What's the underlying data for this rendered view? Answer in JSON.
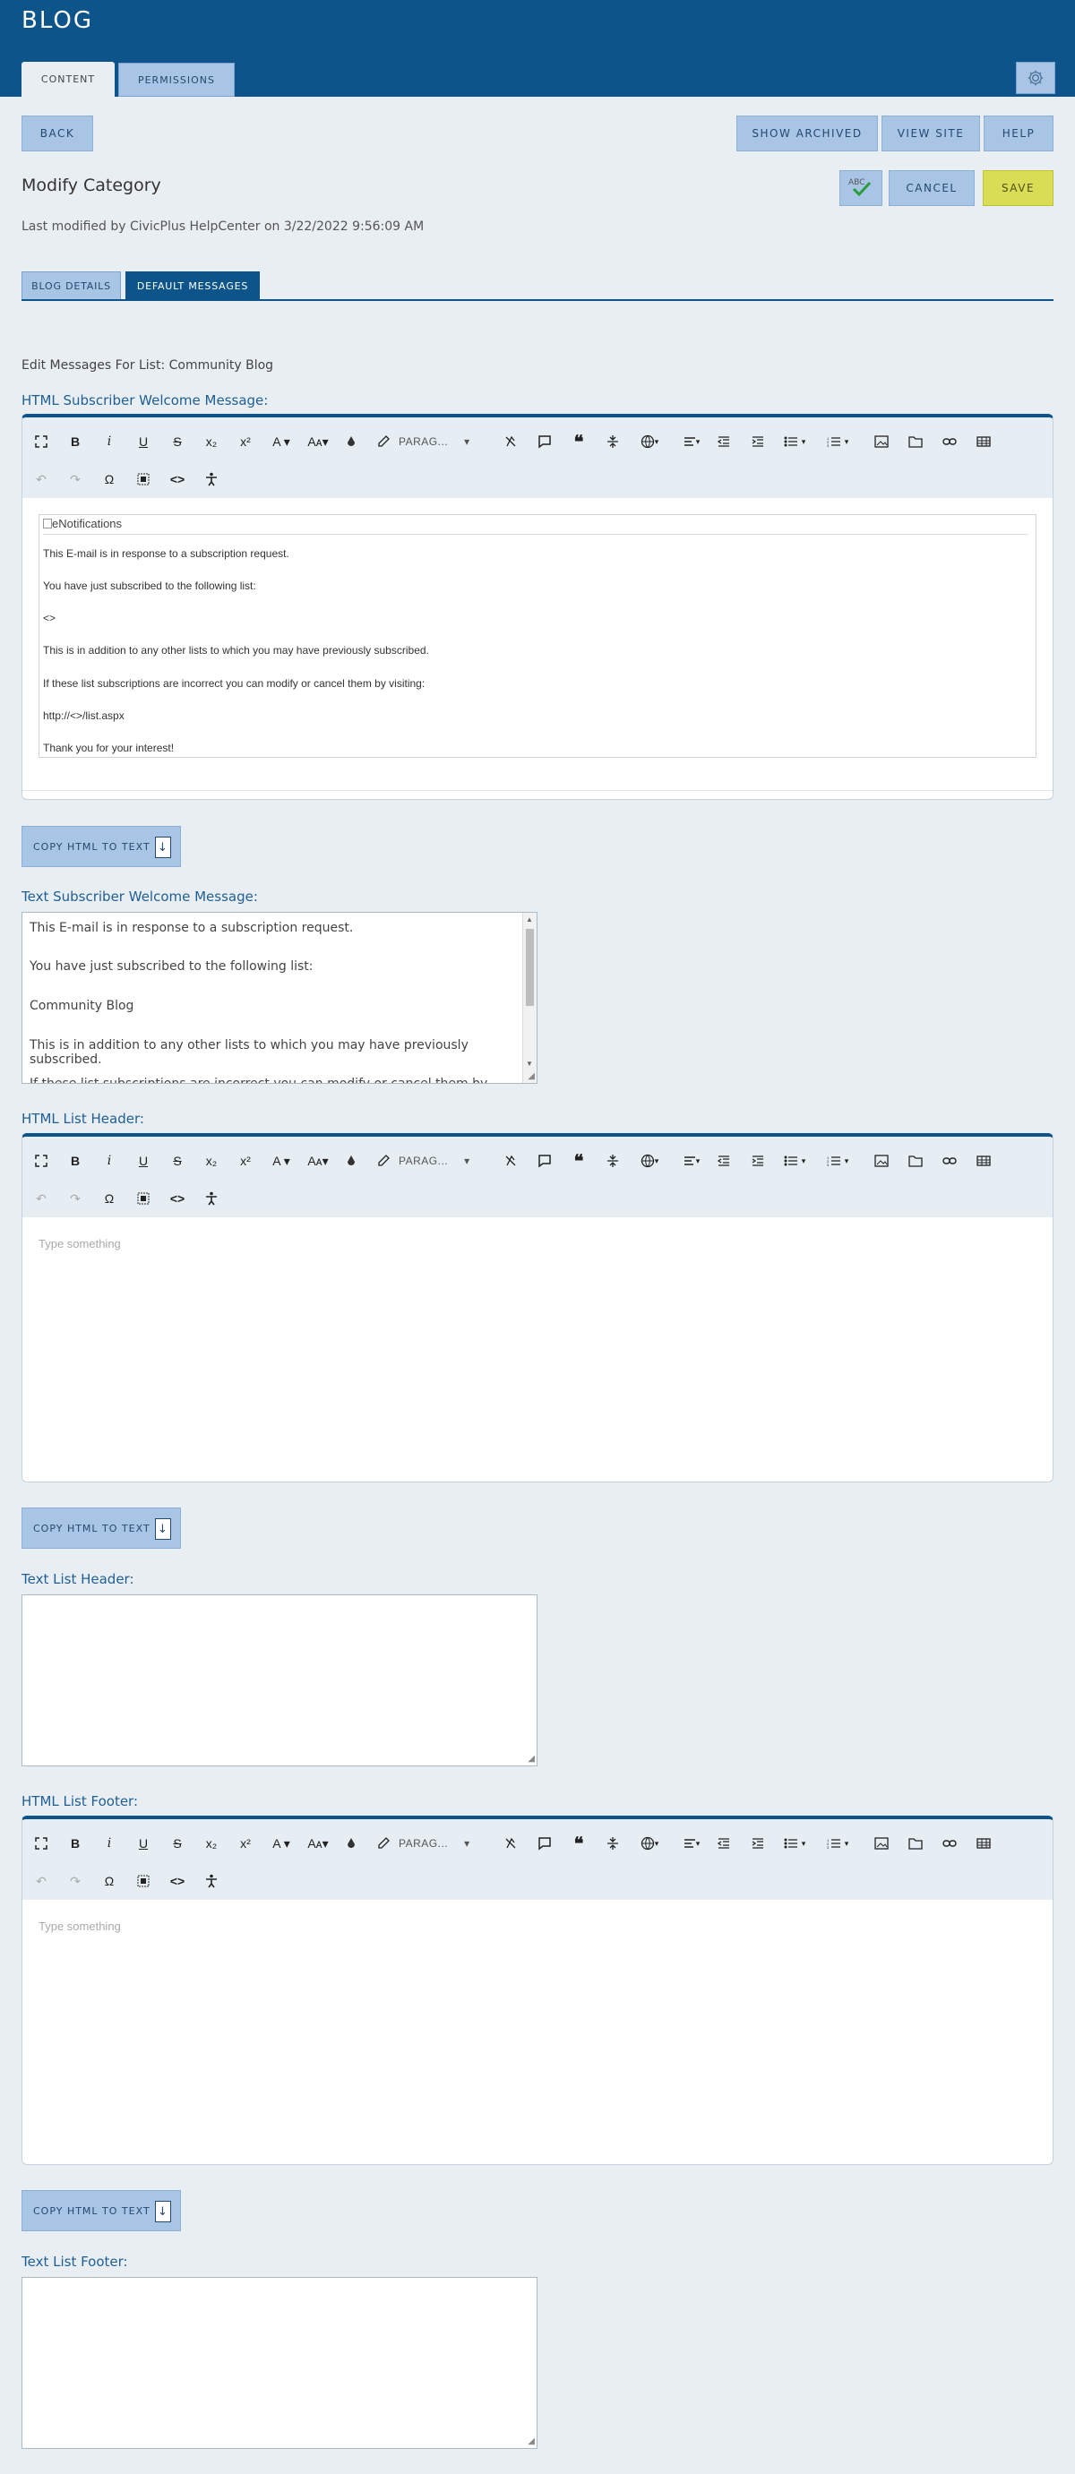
{
  "app": {
    "title": "BLOG"
  },
  "tabs": {
    "content": "CONTENT",
    "permissions": "PERMISSIONS"
  },
  "icons": {
    "settings": "gear-icon",
    "spellcheck": "spellcheck-icon",
    "download": "download-icon"
  },
  "colors": {
    "header": "#0c5489",
    "button": "#a8c5e6",
    "save": "#d9dc55",
    "label": "#1f5f94"
  },
  "actions": {
    "back": "BACK",
    "show_archived": "SHOW ARCHIVED",
    "view_site": "VIEW SITE",
    "help": "HELP",
    "cancel": "CANCEL",
    "save": "SAVE",
    "spellcheck": "ABC"
  },
  "page": {
    "heading": "Modify Category",
    "modified": "Last modified by CivicPlus HelpCenter on 3/22/2022 9:56:09 AM",
    "subtabs": {
      "details": "BLOG DETAILS",
      "default": "DEFAULT MESSAGES"
    },
    "edit_for": "Edit Messages For List: Community Blog"
  },
  "toolbar": {
    "paragraph": "PARAG...",
    "bold": "B",
    "italic": "I",
    "underline": "U",
    "strike": "S",
    "sub": "x₂",
    "sup": "x²",
    "font": "A",
    "size": "Aᴀ",
    "omega": "Ω",
    "code": "<>"
  },
  "sections": {
    "html_welcome": {
      "label": "HTML Subscriber Welcome Message:",
      "image_alt": "eNotifications",
      "lines": [
        "This E-mail is in response to a subscription request.",
        "You have just subscribed to the following list:",
        "<>",
        "This is in addition to any other lists to which you may have previously subscribed.",
        "If these list subscriptions are incorrect you can modify or cancel them by visiting:",
        "http://<>/list.aspx",
        "Thank you for your interest!"
      ]
    },
    "copy_label": "COPY HTML TO TEXT",
    "text_welcome": {
      "label": "Text Subscriber Welcome Message:",
      "lines": [
        "This E-mail is in response to a subscription request.",
        "You have just subscribed to the following list:",
        "Community Blog",
        "This is in addition to any other lists to which you may have previously subscribed.",
        "If these list subscriptions are incorrect you can modify or cancel them by visiting:"
      ]
    },
    "html_header": {
      "label": "HTML List Header:",
      "placeholder": "Type something"
    },
    "text_header": {
      "label": "Text List Header:"
    },
    "html_footer": {
      "label": "HTML List Footer:",
      "placeholder": "Type something"
    },
    "text_footer": {
      "label": "Text List Footer:"
    }
  }
}
